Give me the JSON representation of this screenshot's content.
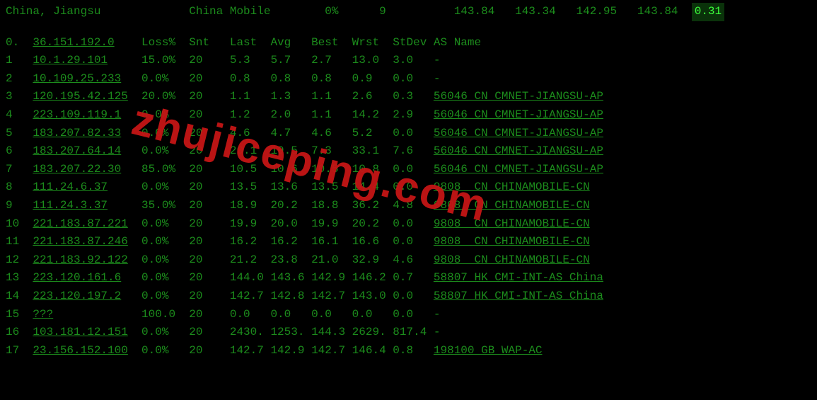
{
  "top": {
    "location": "China, Jiangsu",
    "carrier": "China Mobile",
    "loss": "0%",
    "hops": "9",
    "last": "143.84",
    "avg": "143.34",
    "best": "142.95",
    "wrst": "143.84",
    "stdev": "0.31"
  },
  "headers": {
    "hop": "0.",
    "host": "36.151.192.0",
    "loss": "Loss%",
    "snt": "Snt",
    "last": "Last",
    "avg": "Avg",
    "best": "Best",
    "wrst": "Wrst",
    "stdev": "StDev",
    "as": "AS Name"
  },
  "rows": [
    {
      "hop": "1",
      "host": "10.1.29.101",
      "loss": "15.0%",
      "snt": "20",
      "last": "5.3",
      "avg": "5.7",
      "best": "2.7",
      "wrst": "13.0",
      "stdev": "3.0",
      "as": "-",
      "as_link": false
    },
    {
      "hop": "2",
      "host": "10.109.25.233",
      "loss": "0.0%",
      "snt": "20",
      "last": "0.8",
      "avg": "0.8",
      "best": "0.8",
      "wrst": "0.9",
      "stdev": "0.0",
      "as": "-",
      "as_link": false
    },
    {
      "hop": "3",
      "host": "120.195.42.125",
      "loss": "20.0%",
      "snt": "20",
      "last": "1.1",
      "avg": "1.3",
      "best": "1.1",
      "wrst": "2.6",
      "stdev": "0.3",
      "as": "56046 CN CMNET-JIANGSU-AP",
      "as_link": true
    },
    {
      "hop": "4",
      "host": "223.109.119.1",
      "loss": "0.0%",
      "snt": "20",
      "last": "1.2",
      "avg": "2.0",
      "best": "1.1",
      "wrst": "14.2",
      "stdev": "2.9",
      "as": "56046 CN CMNET-JIANGSU-AP",
      "as_link": true
    },
    {
      "hop": "5",
      "host": "183.207.82.33",
      "loss": "0.0%",
      "snt": "20",
      "last": "4.6",
      "avg": "4.7",
      "best": "4.6",
      "wrst": "5.2",
      "stdev": "0.0",
      "as": "56046 CN CMNET-JIANGSU-AP",
      "as_link": true
    },
    {
      "hop": "6",
      "host": "183.207.64.14",
      "loss": "0.0%",
      "snt": "20",
      "last": "20.1",
      "avg": "19.5",
      "best": "7.3",
      "wrst": "33.1",
      "stdev": "7.6",
      "as": "56046 CN CMNET-JIANGSU-AP",
      "as_link": true
    },
    {
      "hop": "7",
      "host": "183.207.22.30",
      "loss": "85.0%",
      "snt": "20",
      "last": "10.5",
      "avg": "10.6",
      "best": "10.5",
      "wrst": "10.8",
      "stdev": "0.0",
      "as": "56046 CN CMNET-JIANGSU-AP",
      "as_link": true
    },
    {
      "hop": "8",
      "host": "111.24.6.37",
      "loss": "0.0%",
      "snt": "20",
      "last": "13.5",
      "avg": "13.6",
      "best": "13.5",
      "wrst": "14.4",
      "stdev": "0.0",
      "as": "9808  CN CHINAMOBILE-CN",
      "as_link": true
    },
    {
      "hop": "9",
      "host": "111.24.3.37",
      "loss": "35.0%",
      "snt": "20",
      "last": "18.9",
      "avg": "20.2",
      "best": "18.8",
      "wrst": "36.2",
      "stdev": "4.8",
      "as": "9808  CN CHINAMOBILE-CN",
      "as_link": true
    },
    {
      "hop": "10",
      "host": "221.183.87.221",
      "loss": "0.0%",
      "snt": "20",
      "last": "19.9",
      "avg": "20.0",
      "best": "19.9",
      "wrst": "20.2",
      "stdev": "0.0",
      "as": "9808  CN CHINAMOBILE-CN",
      "as_link": true
    },
    {
      "hop": "11",
      "host": "221.183.87.246",
      "loss": "0.0%",
      "snt": "20",
      "last": "16.2",
      "avg": "16.2",
      "best": "16.1",
      "wrst": "16.6",
      "stdev": "0.0",
      "as": "9808  CN CHINAMOBILE-CN",
      "as_link": true
    },
    {
      "hop": "12",
      "host": "221.183.92.122",
      "loss": "0.0%",
      "snt": "20",
      "last": "21.2",
      "avg": "23.8",
      "best": "21.0",
      "wrst": "32.9",
      "stdev": "4.6",
      "as": "9808  CN CHINAMOBILE-CN",
      "as_link": true
    },
    {
      "hop": "13",
      "host": "223.120.161.6",
      "loss": "0.0%",
      "snt": "20",
      "last": "144.0",
      "avg": "143.6",
      "best": "142.9",
      "wrst": "146.2",
      "stdev": "0.7",
      "as": "58807 HK CMI-INT-AS China",
      "as_link": true
    },
    {
      "hop": "14",
      "host": "223.120.197.2",
      "loss": "0.0%",
      "snt": "20",
      "last": "142.7",
      "avg": "142.8",
      "best": "142.7",
      "wrst": "143.0",
      "stdev": "0.0",
      "as": "58807 HK CMI-INT-AS China",
      "as_link": true
    },
    {
      "hop": "15",
      "host": "???",
      "loss": "100.0",
      "snt": "20",
      "last": "0.0",
      "avg": "0.0",
      "best": "0.0",
      "wrst": "0.0",
      "stdev": "0.0",
      "as": "-",
      "as_link": false
    },
    {
      "hop": "16",
      "host": "103.181.12.151",
      "loss": "0.0%",
      "snt": "20",
      "last": "2430.",
      "avg": "1253.",
      "best": "144.3",
      "wrst": "2629.",
      "stdev": "817.4",
      "as": "-",
      "as_link": false
    },
    {
      "hop": "17",
      "host": "23.156.152.100",
      "loss": "0.0%",
      "snt": "20",
      "last": "142.7",
      "avg": "142.9",
      "best": "142.7",
      "wrst": "146.4",
      "stdev": "0.8",
      "as": "198100 GB WAP-AC",
      "as_link": true
    }
  ],
  "watermark": "zhujiceping.com"
}
